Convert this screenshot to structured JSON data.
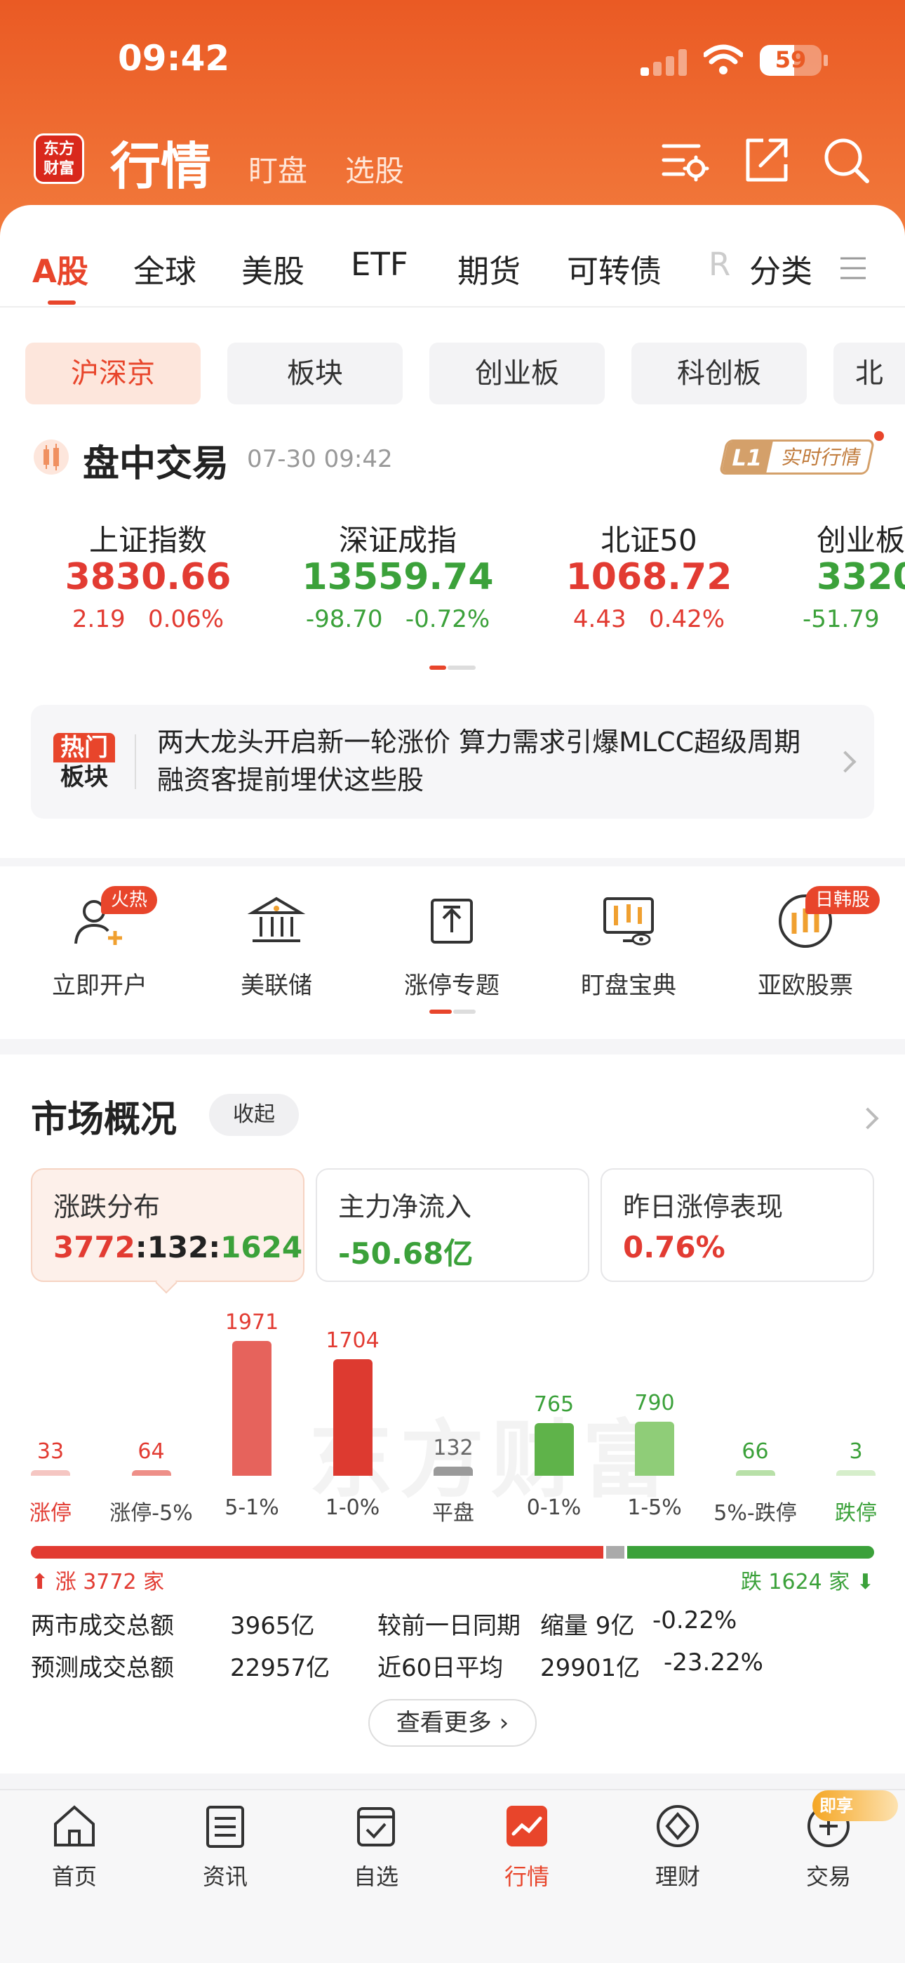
{
  "status": {
    "time": "09:42",
    "battery": "59"
  },
  "header": {
    "logo_text": "东方\n财富",
    "title": "行情",
    "sub": [
      "盯盘",
      "选股"
    ]
  },
  "tabs": [
    "A股",
    "全球",
    "美股",
    "ETF",
    "期货",
    "可转债",
    "R",
    "分类"
  ],
  "pills": [
    "沪深京",
    "板块",
    "创业板",
    "科创板",
    "北"
  ],
  "trade": {
    "title": "盘中交易",
    "time": "07-30 09:42",
    "badge_a": "L1",
    "badge_b": "实时行情"
  },
  "indices": [
    {
      "name": "上证指数",
      "value": "3830.66",
      "change": "2.19   0.06%",
      "dir": "up"
    },
    {
      "name": "深证成指",
      "value": "13559.74",
      "change": "-98.70   -0.72%",
      "dir": "down"
    },
    {
      "name": "北证50",
      "value": "1068.72",
      "change": "4.43   0.42%",
      "dir": "up"
    },
    {
      "name": "创业板",
      "value": "3320",
      "change": "-51.79",
      "dir": "down"
    }
  ],
  "news": {
    "tag_a": "热门",
    "tag_b": "板块",
    "text": "两大龙头开启新一轮涨价 算力需求引爆MLCC超级周期 融资客提前埋伏这些股"
  },
  "shortcuts": [
    {
      "label": "立即开户",
      "icon": "user-add-icon",
      "badge": "火热"
    },
    {
      "label": "美联储",
      "icon": "bank-icon"
    },
    {
      "label": "涨停专题",
      "icon": "limit-up-icon"
    },
    {
      "label": "盯盘宝典",
      "icon": "monitor-eye-icon"
    },
    {
      "label": "亚欧股票",
      "icon": "globe-candle-icon",
      "badge": "日韩股"
    }
  ],
  "market": {
    "title": "市场概况",
    "collapse": "收起",
    "cards": [
      {
        "title": "涨跌分布",
        "value_up": "3772",
        "value_flat": "132",
        "value_down": "1624",
        "sep": ":"
      },
      {
        "title": "主力净流入",
        "value": "-50.68亿"
      },
      {
        "title": "昨日涨停表现",
        "value": "0.76%"
      }
    ],
    "watermark": "东方财富",
    "rise_label": "涨 3772 家",
    "fall_label": "跌 1624 家",
    "stats": [
      {
        "label": "两市成交总额",
        "value": "3965亿",
        "label2": "较前一日同期",
        "value2a": "缩量 9亿",
        "value2b": "-0.22%"
      },
      {
        "label": "预测成交总额",
        "value": "22957亿",
        "label2": "近60日平均",
        "value2a": "29901亿",
        "value2b": "-23.22%"
      }
    ],
    "more": "查看更多"
  },
  "chart_data": {
    "type": "bar",
    "categories": [
      "涨停",
      "涨停-5%",
      "5-1%",
      "1-0%",
      "平盘",
      "0-1%",
      "1-5%",
      "5%-跌停",
      "跌停"
    ],
    "values": [
      33,
      64,
      1971,
      1704,
      132,
      765,
      790,
      66,
      3
    ],
    "ylim": [
      0,
      1971
    ],
    "colors": [
      "#f5c6c2",
      "#ee8f88",
      "#e6635c",
      "#dd3a30",
      "#9a9a9a",
      "#5fb34a",
      "#8fcd78",
      "#b8e0a8",
      "#d6eecb"
    ]
  },
  "nav": [
    {
      "label": "首页",
      "icon": "home-icon"
    },
    {
      "label": "资讯",
      "icon": "news-icon"
    },
    {
      "label": "自选",
      "icon": "watchlist-icon"
    },
    {
      "label": "行情",
      "icon": "chart-icon",
      "active": true
    },
    {
      "label": "理财",
      "icon": "wealth-icon"
    },
    {
      "label": "交易",
      "icon": "trade-icon",
      "badge": "即享"
    }
  ]
}
